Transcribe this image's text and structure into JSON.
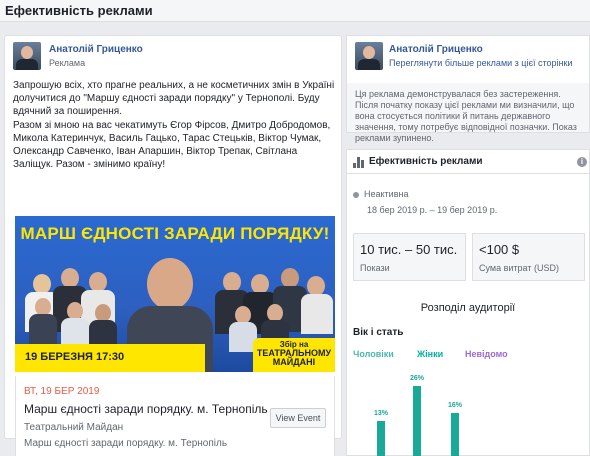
{
  "page": {
    "title": "Ефективність реклами"
  },
  "ad": {
    "advertiser": "Анатолій Гриценко",
    "sponsored": "Реклама",
    "text": [
      "Запрошую всіх, хто прагне реальних, а не косметичних змін в Україні долучитися до \"Маршу єдності заради порядку\" у Тернополі. Буду вдячний за поширення.",
      "Разом зі мною на вас чекатимуть Єгор Фірсов, Дмитро Добродомов, Микола Катеринчук, Василь Гацько, Тарас Стецьків, Віктор Чумак, Олександр Савченко, Іван Апаршин, Віктор Трепак, Світлана Заліщук. Разом - змінимо країну!"
    ],
    "image": {
      "banner": "МАРШ ЄДНОСТІ ЗАРАДИ ПОРЯДКУ!",
      "date": "19 БЕРЕЗНЯ 17:30",
      "meeting_line1": "Збір на",
      "meeting_line2": "ТЕАТРАЛЬНОМУ",
      "meeting_line3": "МАЙДАНІ"
    },
    "event": {
      "date": "ВТ, 19 БЕР 2019",
      "title": "Марш єдності заради порядку. м. Тернопіль",
      "place": "Театральний Майдан",
      "subtitle": "Марш єдності заради порядку. м. Тернопіль",
      "button": "View Event"
    }
  },
  "sidebar": {
    "advertiser": "Анатолій Гриценко",
    "more_link": "Переглянути більше реклами з цієї сторінки",
    "notice": "Ця реклама демонструвалася без застереження. Після початку показу цієї реклами ми визначили, що вона стосується політики й питань державного значення, тому потребує відповідної позначки. Показ реклами зупинено."
  },
  "performance": {
    "title": "Ефективність реклами",
    "info": "i",
    "status": "Неактивна",
    "date_range": "18 бер 2019 р. – 19 бер 2019 р.",
    "impressions_value": "10 тис. – 50 тис.",
    "impressions_label": "Покази",
    "spend_value": "<100 $",
    "spend_label": "Сума витрат (USD)",
    "audience_title": "Розподіл аудиторії",
    "age_gender_title": "Вік і стать",
    "legend": {
      "men": "Чоловіки",
      "women": "Жінки",
      "unknown": "Невідомо"
    },
    "colors": {
      "men": "#4db6ac",
      "women": "#00b2a3",
      "unknown": "#9c6ad6",
      "status_inactive": "#90949c",
      "event_date": "#e65b45"
    }
  },
  "chart_data": {
    "type": "bar",
    "title": "Вік і стать",
    "series": [
      {
        "name": "Жінки",
        "values": [
          13,
          26,
          16
        ]
      }
    ],
    "labels": [
      "13%",
      "26%",
      "16%"
    ]
  }
}
